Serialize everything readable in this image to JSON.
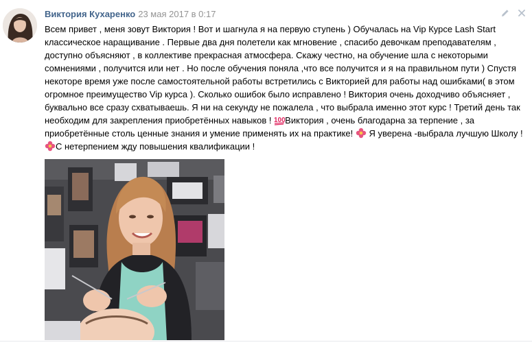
{
  "post": {
    "author": "Виктория Кухаренко",
    "date": "23 мая 2017 в 0:17",
    "text_parts": [
      "Всем привет , меня зовут Виктория ! Вот и шагнула я на первую ступень ) Обучалась на Vip Курсе Lash Start классическое наращивание . Первые два дня полетели как мгновение , спасибо девочкам преподавателям , доступно объясняют , в коллективе прекрасная атмосфера. Скажу честно, на обучение шла с некоторыми сомнениями , получится или нет . Но после обучения поняла ,что все получится и я на правильном пути ) Спустя некоторе время уже после самостоятельной работы встретились с Викторией для работы над ошибками( в этом огромное преимущество Vip курса ). Сколько ошибок было исправлено ! Виктория очень доходчиво объясняет , буквально все сразу схватываешь. Я ни на секунду не пожалела , что выбрала именно этот курс ! Третий день так необходим для закрепления приобретённых навыков !",
      "Виктория , очень благодарна за терпение , за приобретённые столь ценные знания и умение применять их на практике!",
      " Я уверена -выбрала лучшую Школу !",
      "С нетерпением жду повышения квалификации !"
    ],
    "emoji_names": [
      "hundred-points-icon",
      "flower-icon",
      "flower-icon"
    ]
  },
  "actions": [
    "edit-icon",
    "close-icon"
  ],
  "colors": {
    "author": "#42648b",
    "date": "#939393",
    "text": "#000000",
    "emoji_red": "#e0245e",
    "flower": "#e75480"
  }
}
